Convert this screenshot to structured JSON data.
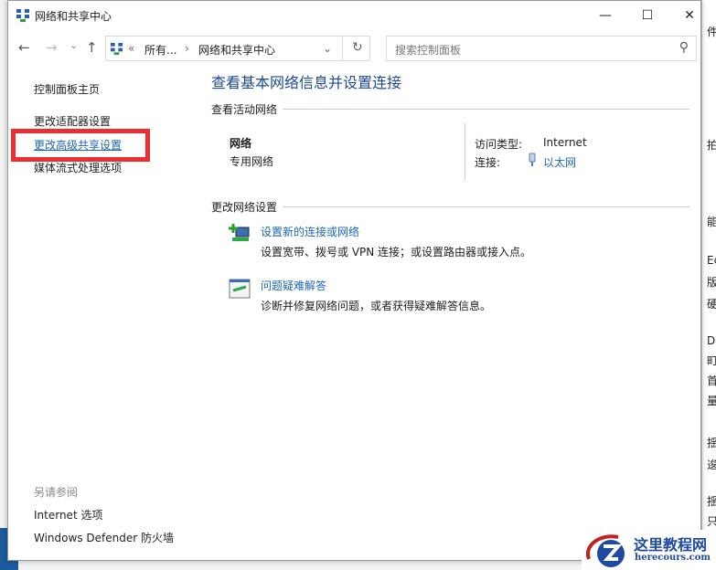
{
  "window": {
    "title": "网络和共享中心",
    "minimize": "—",
    "maximize": "☐",
    "close": "✕"
  },
  "nav": {
    "back": "←",
    "forward": "→",
    "recent": "⌄",
    "up": "↑",
    "breadcrumb": [
      "«",
      "所有...",
      "›",
      "网络和共享中心"
    ],
    "dropdown": "⌄",
    "refresh": "↻",
    "search_placeholder": "搜索控制面板",
    "search_icon": "⚲"
  },
  "sidebar": {
    "items": [
      "控制面板主页",
      "更改适配器设置",
      "更改高级共享设置",
      "媒体流式处理选项"
    ],
    "see_also_title": "另请参阅",
    "see_also": [
      "Internet 选项",
      "Windows Defender 防火墙"
    ],
    "highlight_color": "#ea2f33"
  },
  "main": {
    "title": "查看基本网络信息并设置连接",
    "active_section": "查看活动网络",
    "network_name": "网络",
    "network_type": "专用网络",
    "access_label": "访问类型:",
    "access_value": "Internet",
    "conn_label": "连接:",
    "conn_value": "以太网",
    "change_section": "更改网络设置",
    "tasks": [
      {
        "title": "设置新的连接或网络",
        "desc": "设置宽带、拨号或 VPN 连接；或设置路由器或接入点。"
      },
      {
        "title": "问题疑难解答",
        "desc": "诊断并修复网络问题，或者获得疑难解答信息。"
      }
    ]
  },
  "background_strip": [
    "件",
    "拍",
    "能",
    "Ec",
    "版",
    "硬",
    "D",
    "町",
    "首",
    "量",
    "揺",
    "逡",
    "揺",
    "只"
  ],
  "watermark": {
    "name": "这里教程网",
    "url": "herecours.com"
  }
}
